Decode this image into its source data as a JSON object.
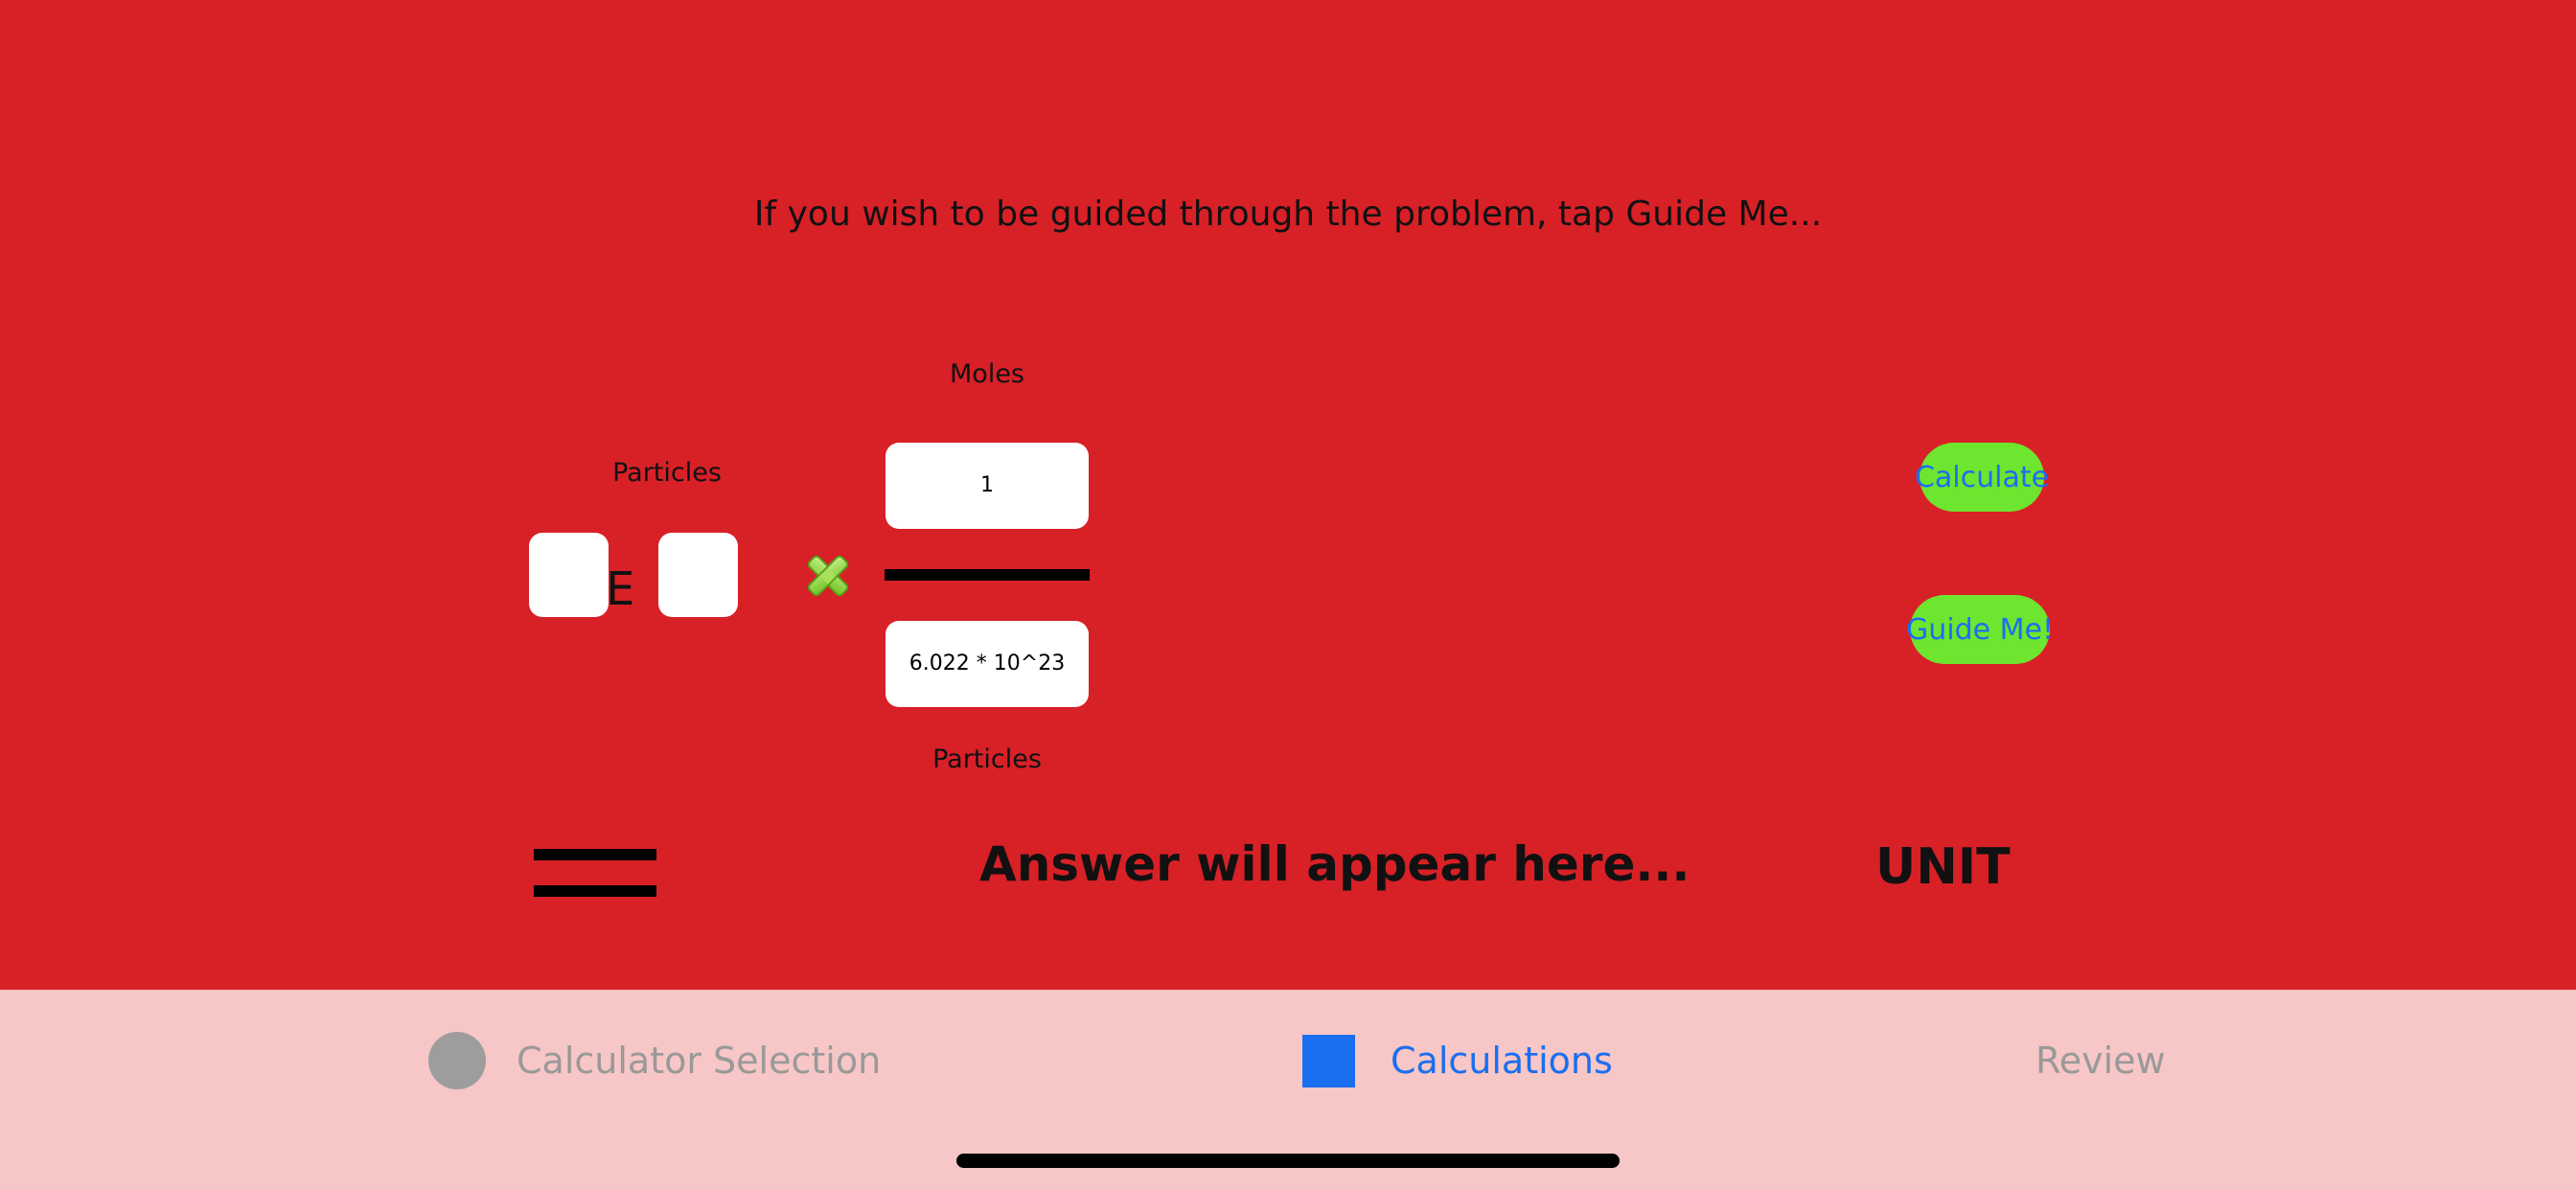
{
  "main": {
    "hint": "If you wish to be guided through the problem, tap Guide Me...",
    "left_label": "Particles",
    "e_symbol": "E",
    "multiply_icon": "x-mark-icon",
    "numerator_label": "Moles",
    "numerator_value": "1",
    "denominator_value": "6.022 * 10^23",
    "denominator_label": "Particles",
    "calculate_button": "Calculate",
    "guide_button": "Guide Me!",
    "equals_icon": "equals-icon",
    "answer_placeholder": "Answer will appear here...",
    "unit": "UNIT"
  },
  "tabs": [
    {
      "label": "Calculator Selection",
      "icon": "circle-icon",
      "active": false
    },
    {
      "label": "Calculations",
      "icon": "square-icon",
      "active": true
    },
    {
      "label": "Review",
      "icon": "",
      "active": false
    }
  ],
  "colors": {
    "background": "#d82027",
    "tabbar": "#f7c6c6",
    "button_fill": "#6ee52e",
    "accent": "#1a6ff0",
    "inactive": "#999999"
  }
}
